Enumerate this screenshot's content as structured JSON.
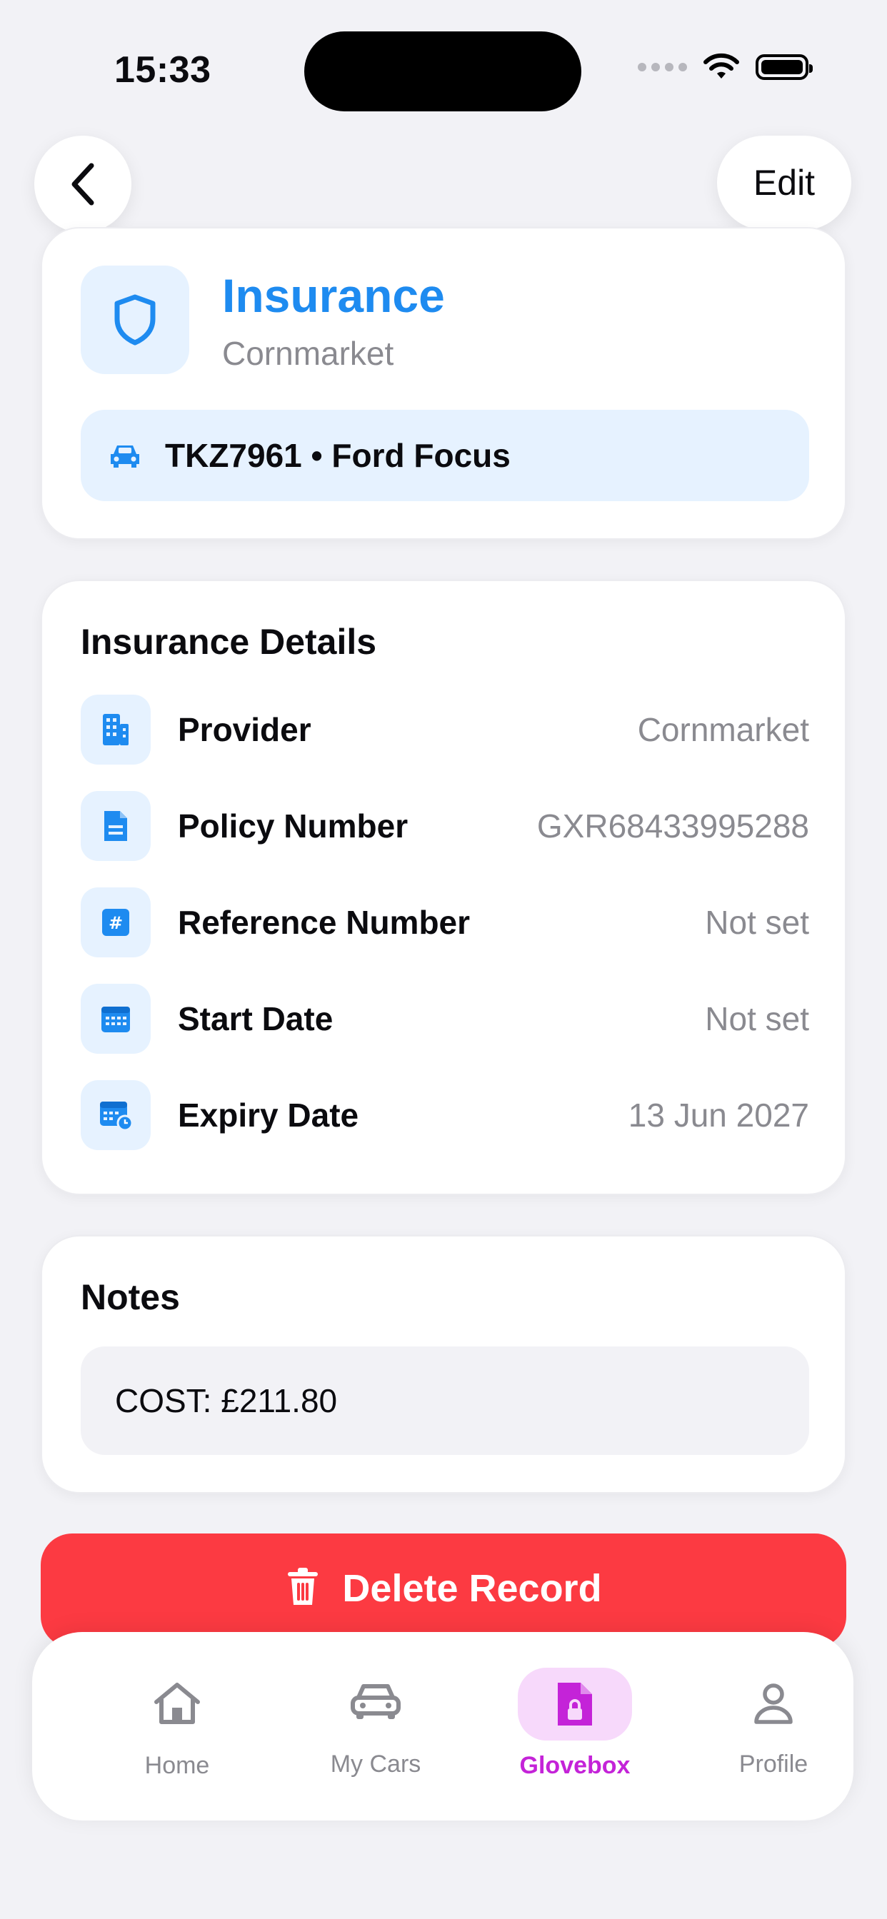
{
  "status_bar": {
    "time": "15:33"
  },
  "nav": {
    "edit_label": "Edit"
  },
  "record": {
    "title": "Insurance",
    "provider_subtitle": "Cornmarket",
    "vehicle": "TKZ7961 • Ford Focus"
  },
  "details": {
    "title": "Insurance Details",
    "rows": [
      {
        "label": "Provider",
        "value": "Cornmarket",
        "icon": "building-icon"
      },
      {
        "label": "Policy Number",
        "value": "GXR68433995288",
        "icon": "document-icon"
      },
      {
        "label": "Reference Number",
        "value": "Not set",
        "icon": "hash-icon"
      },
      {
        "label": "Start Date",
        "value": "Not set",
        "icon": "calendar-icon"
      },
      {
        "label": "Expiry Date",
        "value": "13 Jun 2027",
        "icon": "calendar-clock-icon"
      }
    ]
  },
  "notes": {
    "title": "Notes",
    "text": "COST: £211.80"
  },
  "actions": {
    "delete_label": "Delete Record"
  },
  "tabs": [
    {
      "label": "Home",
      "active": false
    },
    {
      "label": "My Cars",
      "active": false
    },
    {
      "label": "Glovebox",
      "active": true
    },
    {
      "label": "Profile",
      "active": false
    }
  ],
  "colors": {
    "accent_blue": "#1e8bf0",
    "icon_bg": "#e6f2ff",
    "delete_red": "#fc3a42",
    "active_tab": "#c423d8",
    "active_tab_bg": "#f7d9fb"
  }
}
